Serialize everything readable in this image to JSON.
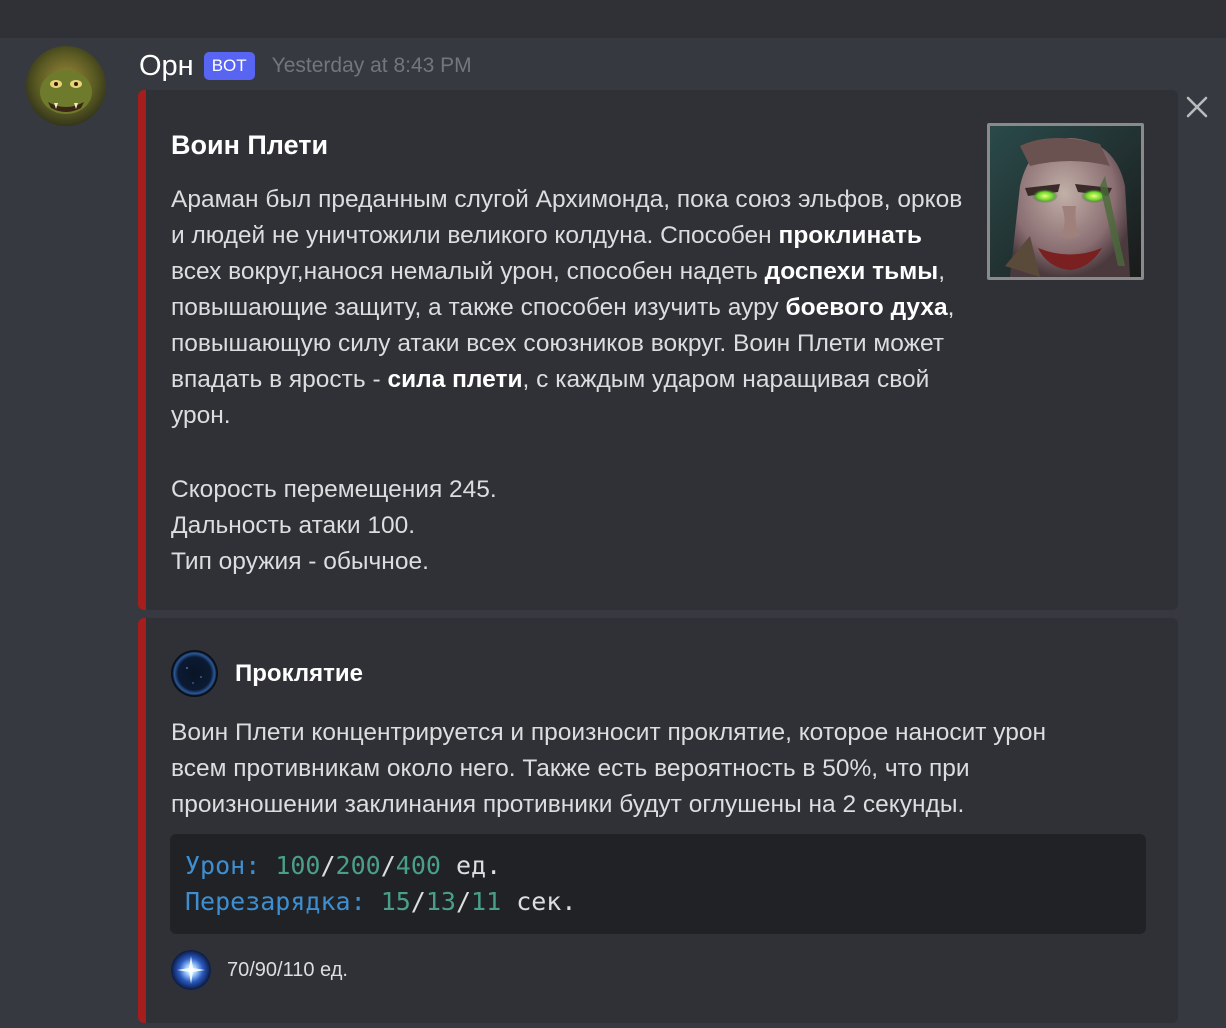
{
  "message": {
    "username": "Орн",
    "bot_tag": "BOT",
    "timestamp": "Yesterday at 8:43 PM",
    "avatar_icon": "orc-avatar-icon",
    "close_icon": "close-icon"
  },
  "embed1": {
    "bar_color": "#a51e1e",
    "title": "Воин Плети",
    "description": [
      {
        "text": "Араман был преданным слугой Архимонда, пока союз эльфов, орков и людей не уничтожили великого колдуна. Способен ",
        "bold": false
      },
      {
        "text": "проклинать",
        "bold": true
      },
      {
        "text": " всех вокруг,нанося немалый урон, способен надеть ",
        "bold": false
      },
      {
        "text": "доспехи тьмы",
        "bold": true
      },
      {
        "text": ", повышающие защиту, а также способен изучить ауру ",
        "bold": false
      },
      {
        "text": "боевого духа",
        "bold": true
      },
      {
        "text": ", повышающую силу атаки всех союзников вокруг. Воин Плети может впадать в ярость - ",
        "bold": false
      },
      {
        "text": "сила плети",
        "bold": true
      },
      {
        "text": ", с каждым ударом наращивая свой урон.",
        "bold": false
      }
    ],
    "stat_speed": "Скорость перемещения 245.",
    "stat_range": "Дальность атаки 100.",
    "stat_weapon": "Тип оружия - обычное.",
    "thumbnail_icon": "hero-portrait-icon"
  },
  "embed2": {
    "bar_color": "#a51e1e",
    "author_name": "Проклятие",
    "author_icon": "curse-spell-icon",
    "description": "Воин Плети концентрируется и произносит проклятие, которое наносит урон всем противникам около него. Также есть вероятность в 50%, что при произношении заклинания противники будут оглушены на 2 секунды.",
    "code": {
      "damage_label": "Урон:",
      "damage_1": "100",
      "sep": "/",
      "damage_2": "200",
      "damage_3": "400",
      "damage_unit": "ед.",
      "cooldown_label": "Перезарядка:",
      "cooldown_1": "15",
      "cooldown_2": "13",
      "cooldown_3": "11",
      "cooldown_unit": "сек."
    },
    "footer_text": "70/90/110 ед.",
    "footer_icon": "mana-icon"
  }
}
